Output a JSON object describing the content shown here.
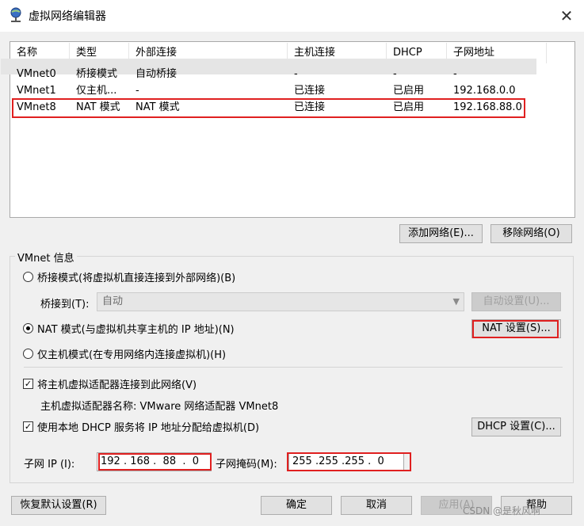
{
  "window": {
    "title": "虚拟网络编辑器"
  },
  "table": {
    "headers": [
      "名称",
      "类型",
      "外部连接",
      "主机连接",
      "DHCP",
      "子网地址"
    ],
    "rows": [
      [
        "VMnet0",
        "桥接模式",
        "自动桥接",
        "-",
        "-",
        "-"
      ],
      [
        "VMnet1",
        "仅主机...",
        "-",
        "已连接",
        "已启用",
        "192.168.0.0"
      ],
      [
        "VMnet8",
        "NAT 模式",
        "NAT 模式",
        "已连接",
        "已启用",
        "192.168.88.0"
      ]
    ]
  },
  "buttons": {
    "add_network": "添加网络(E)...",
    "remove_network": "移除网络(O)",
    "auto_settings": "自动设置(U)...",
    "nat_settings": "NAT 设置(S)...",
    "dhcp_settings": "DHCP 设置(C)...",
    "restore_defaults": "恢复默认设置(R)",
    "ok": "确定",
    "cancel": "取消",
    "apply": "应用(A)",
    "help": "帮助"
  },
  "vmnet_info": {
    "group_label": "VMnet 信息",
    "bridged_radio": "桥接模式(将虚拟机直接连接到外部网络)(B)",
    "bridged_to_label": "桥接到(T):",
    "bridged_to_value": "自动",
    "nat_radio": "NAT 模式(与虚拟机共享主机的 IP 地址)(N)",
    "hostonly_radio": "仅主机模式(在专用网络内连接虚拟机)(H)",
    "connect_adapter_check": "将主机虚拟适配器连接到此网络(V)",
    "adapter_name": "主机虚拟适配器名称: VMware 网络适配器 VMnet8",
    "dhcp_check": "使用本地 DHCP 服务将 IP 地址分配给虚拟机(D)",
    "subnet_ip_label": "子网 IP (I):",
    "subnet_ip_value": "192 . 168 .  88  .  0",
    "subnet_mask_label": "子网掩码(M):",
    "subnet_mask_value": "255 .255 .255 .  0"
  },
  "watermark": "CSDN @是秋风啊"
}
